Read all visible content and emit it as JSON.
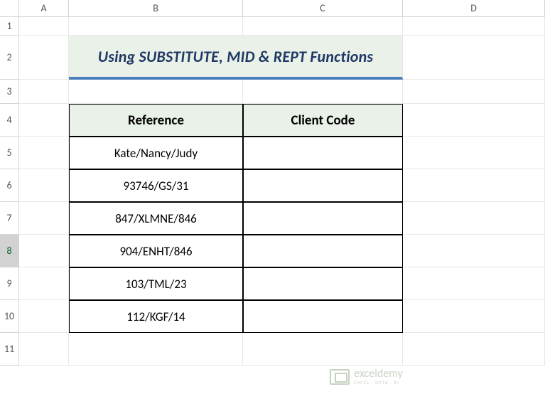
{
  "columns": [
    "A",
    "B",
    "C",
    "D"
  ],
  "rows": [
    "1",
    "2",
    "3",
    "4",
    "5",
    "6",
    "7",
    "8",
    "9",
    "10",
    "11"
  ],
  "selectedRow": "8",
  "title": "Using SUBSTITUTE, MID & REPT Functions",
  "table": {
    "headers": {
      "reference": "Reference",
      "clientCode": "Client Code"
    },
    "rows": [
      {
        "reference": "Kate/Nancy/Judy",
        "clientCode": ""
      },
      {
        "reference": "93746/GS/31",
        "clientCode": ""
      },
      {
        "reference": "847/XLMNE/846",
        "clientCode": ""
      },
      {
        "reference": "904/ENHT/846",
        "clientCode": ""
      },
      {
        "reference": "103/TML/23",
        "clientCode": ""
      },
      {
        "reference": "112/KGF/14",
        "clientCode": ""
      }
    ]
  },
  "watermark": {
    "main": "exceldemy",
    "sub": "EXCEL · DATA · BI"
  },
  "chart_data": {
    "type": "table",
    "title": "Using SUBSTITUTE, MID & REPT Functions",
    "headers": [
      "Reference",
      "Client Code"
    ],
    "rows": [
      [
        "Kate/Nancy/Judy",
        ""
      ],
      [
        "93746/GS/31",
        ""
      ],
      [
        "847/XLMNE/846",
        ""
      ],
      [
        "904/ENHT/846",
        ""
      ],
      [
        "103/TML/23",
        ""
      ],
      [
        "112/KGF/14",
        ""
      ]
    ]
  }
}
